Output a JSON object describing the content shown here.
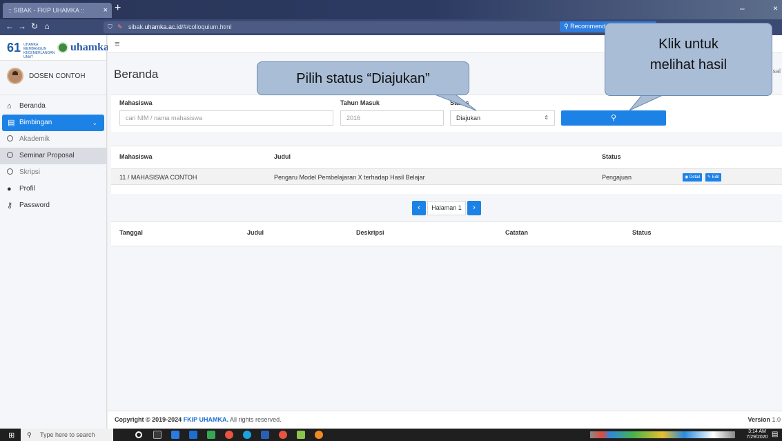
{
  "browser": {
    "tab_title": ":: SIBAK - FKIP UHAMKA ::",
    "tab_close": "×",
    "new_tab": "+",
    "url_path_prefix": "sibak.",
    "url_host": "uhamka.ac.id",
    "url_path": "/#/colloquium.html",
    "recommendation_text": "Recommendat"
  },
  "brand": {
    "logo_number": "61",
    "logo_tagline": "UHAMKA MEMBANGUN KECEMERLANGAN UMAT",
    "logo_name": "uhamka"
  },
  "user": {
    "name": "DOSEN CONTOH"
  },
  "sidebar": {
    "items": [
      {
        "label": "Beranda",
        "icon": "home-icon"
      },
      {
        "label": "Bimbingan",
        "icon": "book-icon"
      },
      {
        "label": "Akademik",
        "icon": "circle-icon"
      },
      {
        "label": "Seminar Proposal",
        "icon": "circle-icon"
      },
      {
        "label": "Skripsi",
        "icon": "circle-icon"
      },
      {
        "label": "Profil",
        "icon": "user-icon"
      },
      {
        "label": "Password",
        "icon": "key-icon"
      }
    ]
  },
  "main": {
    "title": "Beranda",
    "breadcrumb_fragment": "sal"
  },
  "filters": {
    "mahasiswa_label": "Mahasiswa",
    "mahasiswa_placeholder": "cari NIM / nama mahasiswa",
    "tahun_label": "Tahun Masuk",
    "tahun_placeholder": "2016",
    "status_label": "Status",
    "status_value": "Diajukan"
  },
  "table": {
    "headers": [
      "Mahasiswa",
      "Judul",
      "Status"
    ],
    "rows": [
      {
        "mahasiswa": "11 / MAHASISWA CONTOH",
        "judul": "Pengaru Model Pembelajaran X terhadap Hasil Belajar",
        "status": "Pengajuan",
        "detail_label": "Detail",
        "edit_label": "Edit"
      }
    ]
  },
  "pager": {
    "label": "Halaman 1"
  },
  "history": {
    "headers": [
      "Tanggal",
      "Judul",
      "Deskripsi",
      "Catatan",
      "Status"
    ]
  },
  "footer": {
    "copyright_prefix": "Copyright © 2019-2024",
    "org": "FKIP UHAMKA.",
    "copyright_suffix": "All rights reserved.",
    "version_label": "Version",
    "version_value": "1.0"
  },
  "callouts": {
    "status": "Pilih status “Diajukan”",
    "search_line1": "Klik untuk",
    "search_line2": "melihat hasil"
  },
  "taskbar": {
    "search_placeholder": "Type here to search",
    "time": "3:14 AM",
    "date": "7/29/2020"
  },
  "colors": {
    "primary": "#1d82e6",
    "callout": "#a9bdd6",
    "browser_chrome": "#2c3a62"
  }
}
